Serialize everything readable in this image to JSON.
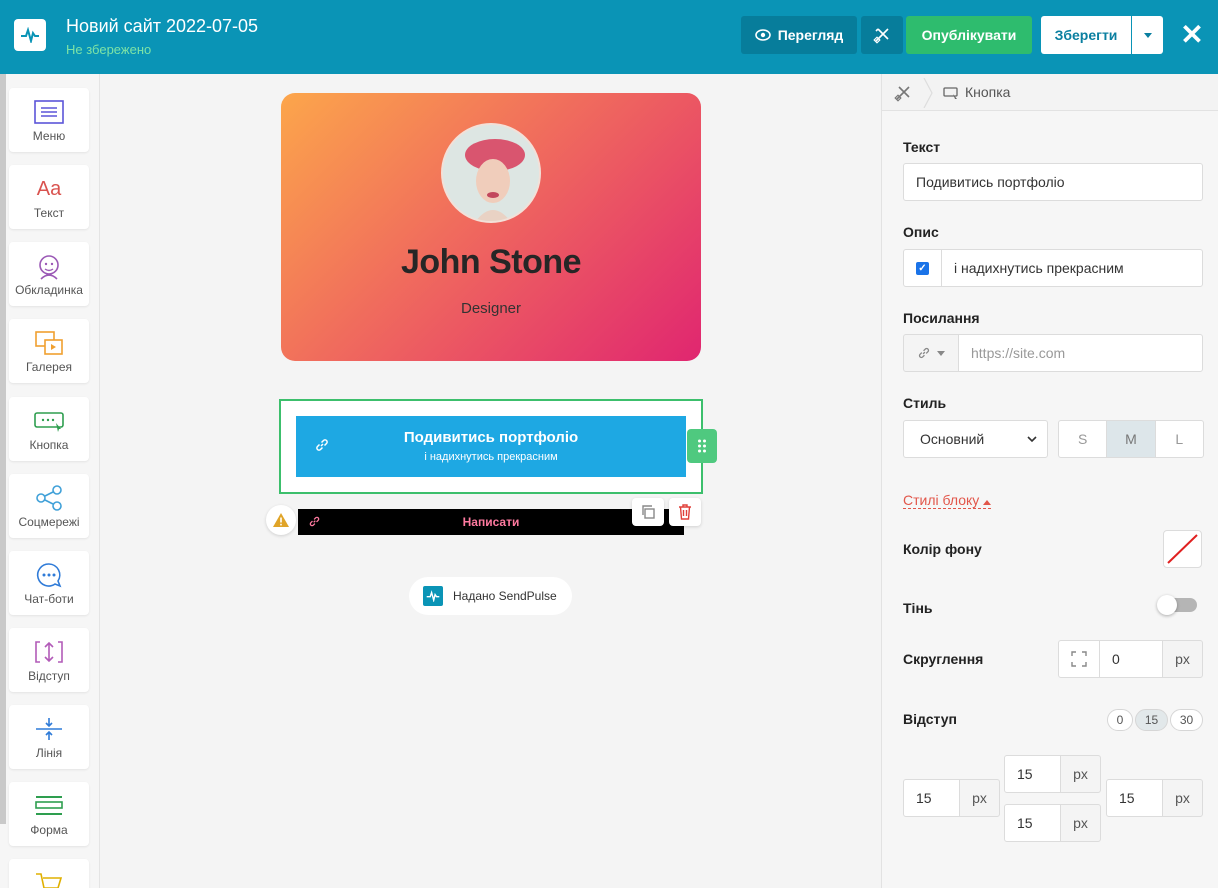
{
  "header": {
    "title": "Новий сайт 2022-07-05",
    "status": "Не збережено",
    "preview_label": "Перегляд",
    "publish_label": "Опублікувати",
    "save_label": "Зберегти",
    "colors": {
      "bar": "#0a94b6",
      "publish": "#2ebc6e",
      "preview": "#077d9b"
    }
  },
  "sidebar": {
    "items": [
      {
        "label": "Меню",
        "icon": "menu-icon"
      },
      {
        "label": "Текст",
        "icon": "text-icon"
      },
      {
        "label": "Обкладинка",
        "icon": "cover-icon"
      },
      {
        "label": "Галерея",
        "icon": "gallery-icon"
      },
      {
        "label": "Кнопка",
        "icon": "button-icon"
      },
      {
        "label": "Соцмережі",
        "icon": "share-icon"
      },
      {
        "label": "Чат-боти",
        "icon": "chat-icon"
      },
      {
        "label": "Відступ",
        "icon": "spacing-icon"
      },
      {
        "label": "Лінія",
        "icon": "line-icon"
      },
      {
        "label": "Форма",
        "icon": "form-icon"
      },
      {
        "label": "",
        "icon": "cart-icon"
      }
    ]
  },
  "canvas": {
    "card": {
      "name": "John Stone",
      "role": "Designer"
    },
    "main_button": {
      "text": "Подивитись портфоліо",
      "description": "і надихнутись прекрасним",
      "color": "#1ea8e3"
    },
    "second_button": {
      "text": "Написати",
      "color": "#000000",
      "text_color": "#ff7aa0"
    },
    "powered_by": "Надано SendPulse"
  },
  "panel": {
    "breadcrumb": "Кнопка",
    "text_label": "Текст",
    "text_value": "Подивитись портфоліо",
    "desc_label": "Опис",
    "desc_value": "і надихнутись прекрасним",
    "desc_checked": true,
    "link_label": "Посилання",
    "link_placeholder": "https://site.com",
    "style_label": "Стиль",
    "style_value": "Основний",
    "sizes": [
      "S",
      "M",
      "L"
    ],
    "size_selected": "M",
    "block_styles_label": "Стилі блоку",
    "bg_label": "Колір фону",
    "shadow_label": "Тінь",
    "shadow_on": false,
    "radius_label": "Скруглення",
    "radius_value": "0",
    "unit": "px",
    "padding_label": "Відступ",
    "padding_presets": [
      "0",
      "15",
      "30"
    ],
    "padding_selected": "15",
    "padding": {
      "left": "15",
      "top": "15",
      "bottom": "15",
      "right": "15"
    }
  }
}
